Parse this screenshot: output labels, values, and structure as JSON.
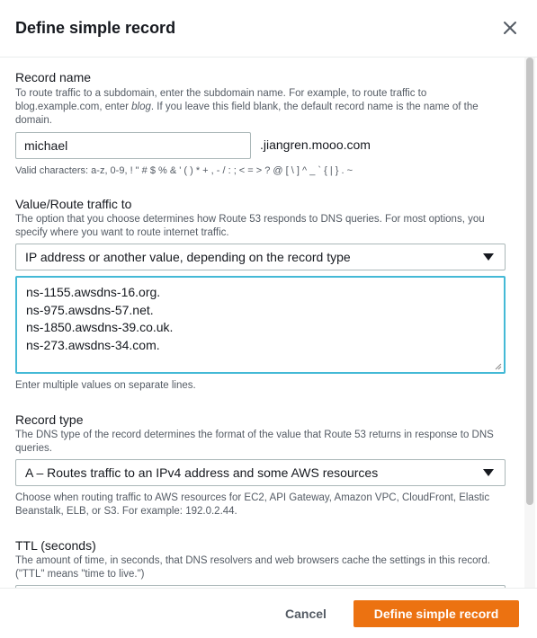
{
  "modal": {
    "title": "Define simple record"
  },
  "record_name": {
    "label": "Record name",
    "description_part1": "To route traffic to a subdomain, enter the subdomain name. For example, to route traffic to blog.example.com, enter ",
    "description_em": "blog",
    "description_part2": ". If you leave this field blank, the default record name is the name of the domain.",
    "value": "michael",
    "suffix": ".jiangren.mooo.com",
    "hint": "Valid characters: a-z, 0-9, ! \" # $ % & ' ( ) * + , - / : ; < = > ? @ [ \\ ] ^ _ ` { | } . ~"
  },
  "value_route": {
    "label": "Value/Route traffic to",
    "description": "The option that you choose determines how Route 53 responds to DNS queries. For most options, you specify where you want to route internet traffic.",
    "selected": "IP address or another value, depending on the record type",
    "values": [
      "ns-1155.awsdns-16.org.",
      "ns-975.awsdns-57.net.",
      "ns-1850.awsdns-39.co.uk.",
      "ns-273.awsdns-34.com."
    ],
    "hint": "Enter multiple values on separate lines."
  },
  "record_type": {
    "label": "Record type",
    "description": "The DNS type of the record determines the format of the value that Route 53 returns in response to DNS queries.",
    "selected": "A – Routes traffic to an IPv4 address and some AWS resources",
    "hint": "Choose when routing traffic to AWS resources for EC2, API Gateway, Amazon VPC, CloudFront, Elastic Beanstalk, ELB, or S3. For example: 192.0.2.44."
  },
  "ttl": {
    "label": "TTL (seconds)",
    "description": "The amount of time, in seconds, that DNS resolvers and web browsers cache the settings in this record. (\"TTL\" means \"time to live.\")"
  },
  "footer": {
    "cancel_label": "Cancel",
    "submit_label": "Define simple record"
  }
}
